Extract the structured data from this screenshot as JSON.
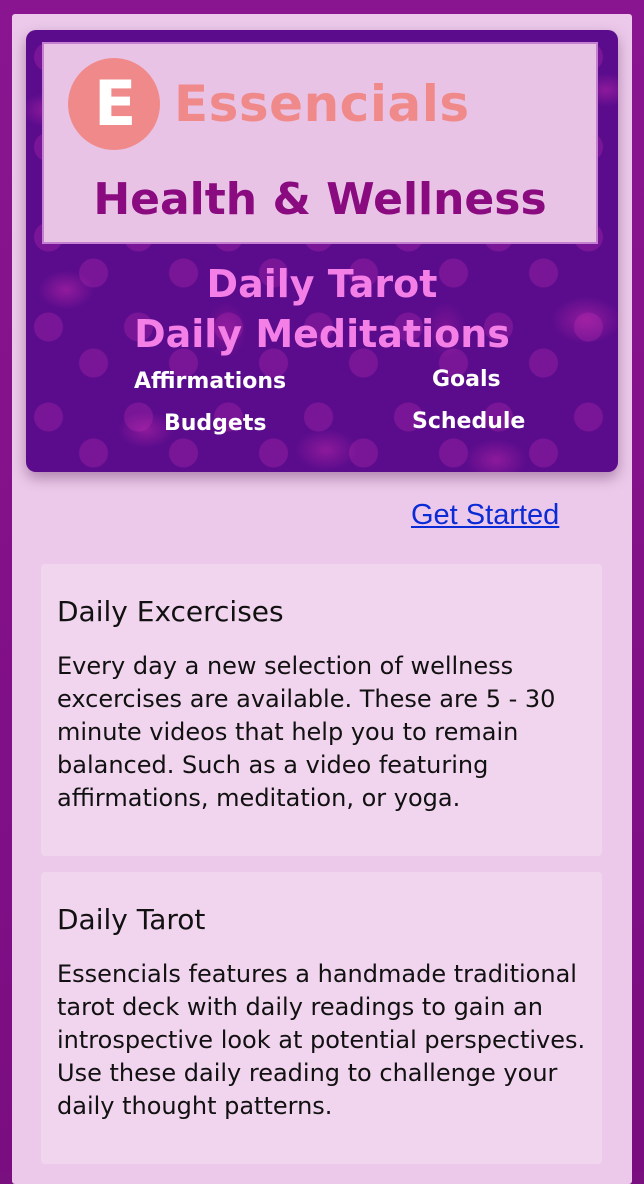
{
  "banner": {
    "logo_letter": "E",
    "brand": "Essencials",
    "subtitle": "Health & Wellness",
    "line1": "Daily Tarot",
    "line2": "Daily Meditations",
    "features": [
      "Affirmations",
      "Goals",
      "Budgets",
      "Schedule"
    ]
  },
  "cta": {
    "get_started": "Get Started"
  },
  "cards": [
    {
      "title": "Daily Excercises",
      "body": "Every day a new selection of wellness excercises are available. These are 5 - 30 minute videos that help you to remain balanced. Such as a video featuring affirmations, meditation, or yoga."
    },
    {
      "title": "Daily Tarot",
      "body": "Essencials features a handmade traditional tarot deck with daily readings to gain an introspective look at potential perspectives. Use these daily reading to challenge your daily thought patterns."
    }
  ],
  "colors": {
    "frame": "#7a0f80",
    "panel": "#ecc9ea",
    "banner_bg": "#5a0c8c",
    "brand_coral": "#f08a8a",
    "subtitle_purple": "#8a0a7f",
    "banner_pink": "#f47fe6",
    "link_blue": "#0a2bd6",
    "card_bg": "#f1d4ee"
  }
}
